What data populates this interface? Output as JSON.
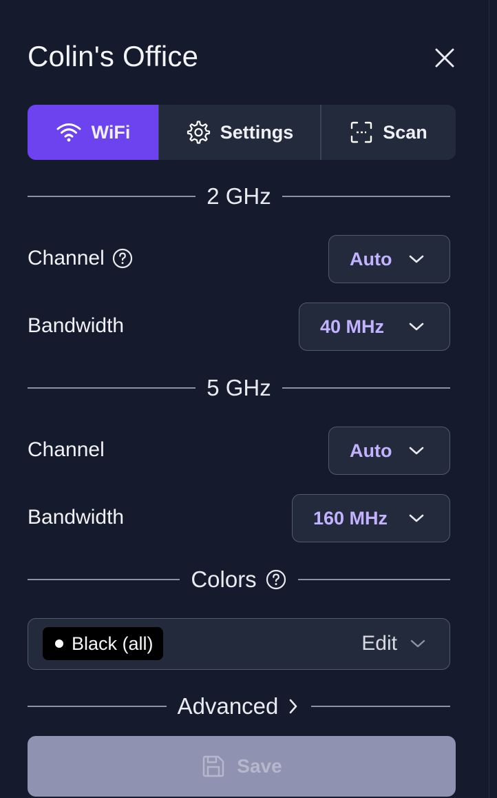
{
  "header": {
    "title": "Colin's Office"
  },
  "tabs": [
    {
      "label": "WiFi",
      "icon": "wifi-icon",
      "active": true
    },
    {
      "label": "Settings",
      "icon": "gear-icon",
      "active": false
    },
    {
      "label": "Scan",
      "icon": "scan-icon",
      "active": false
    }
  ],
  "band_2ghz": {
    "heading": "2 GHz",
    "channel_label": "Channel",
    "channel_value": "Auto",
    "bandwidth_label": "Bandwidth",
    "bandwidth_value": "40 MHz"
  },
  "band_5ghz": {
    "heading": "5 GHz",
    "channel_label": "Channel",
    "channel_value": "Auto",
    "bandwidth_label": "Bandwidth",
    "bandwidth_value": "160 MHz"
  },
  "colors": {
    "heading": "Colors",
    "selected_chip": "Black (all)",
    "edit_label": "Edit"
  },
  "advanced": {
    "label": "Advanced"
  },
  "save": {
    "label": "Save"
  },
  "theme": {
    "background": "#151b2c",
    "accent": "#6d42ef",
    "select_value_color": "#c2b2ff",
    "save_disabled": "#9092b2"
  }
}
